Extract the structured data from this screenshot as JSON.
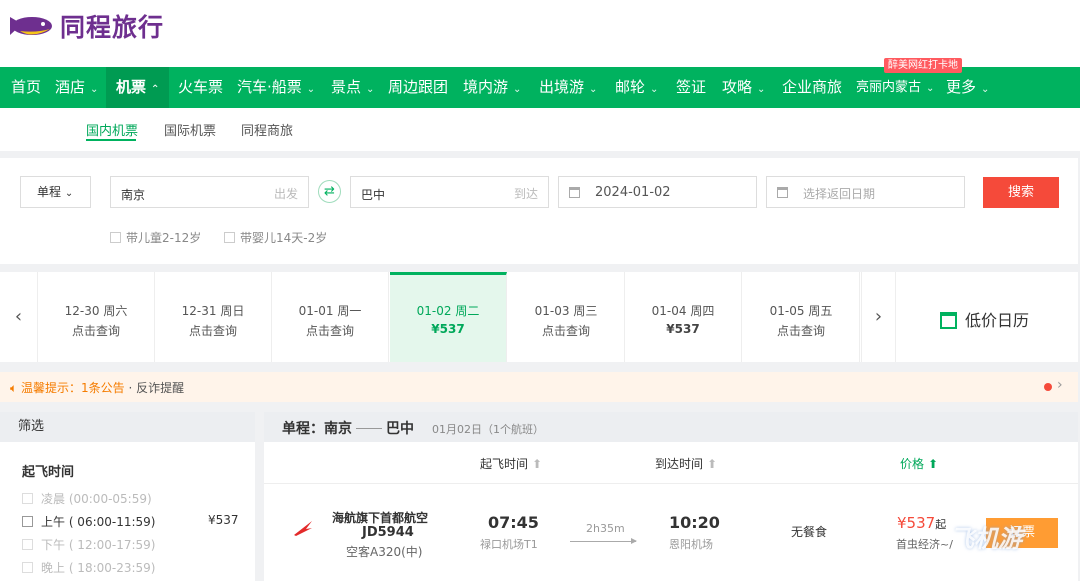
{
  "brand": {
    "name": "同程旅行",
    "color": "#6e2f8f",
    "icon": "flying-fish-logo-icon"
  },
  "nav": {
    "items": [
      {
        "label": "首页",
        "chevron": false
      },
      {
        "label": "酒店",
        "chevron": true
      },
      {
        "label": "机票",
        "chevron": true,
        "active": true
      },
      {
        "label": "火车票",
        "chevron": false
      },
      {
        "label": "汽车·船票",
        "chevron": true
      },
      {
        "label": "景点",
        "chevron": true
      },
      {
        "label": "周边跟团",
        "chevron": false
      },
      {
        "label": "境内游",
        "chevron": true
      },
      {
        "label": "出境游",
        "chevron": true
      },
      {
        "label": "邮轮",
        "chevron": true
      },
      {
        "label": "签证",
        "chevron": false
      },
      {
        "label": "攻略",
        "chevron": true
      },
      {
        "label": "企业商旅",
        "chevron": false
      },
      {
        "label": "亮丽内蒙古",
        "chevron": true
      },
      {
        "label": "更多",
        "chevron": true
      }
    ],
    "badge": "醉美网红打卡地",
    "color": "#00b25f"
  },
  "subnav": {
    "items": [
      "国内机票",
      "国际机票",
      "同程商旅"
    ],
    "active_index": 0
  },
  "search": {
    "trip_type": "单程",
    "from_city": "南京",
    "from_hint": "出发",
    "to_city": "巴中",
    "to_hint": "到达",
    "depart_date": "2024-01-02",
    "return_placeholder": "选择返回日期",
    "button": "搜索",
    "child_option": "带儿童2-12岁",
    "infant_option": "带婴儿14天-2岁",
    "button_color": "#f54a3a"
  },
  "datebar": {
    "days": [
      {
        "date": "12-30 周六",
        "info": "点击查询",
        "has_price": false
      },
      {
        "date": "12-31 周日",
        "info": "点击查询",
        "has_price": false
      },
      {
        "date": "01-01 周一",
        "info": "点击查询",
        "has_price": false
      },
      {
        "date": "01-02 周二",
        "info": "¥537",
        "has_price": true,
        "active": true
      },
      {
        "date": "01-03 周三",
        "info": "点击查询",
        "has_price": false
      },
      {
        "date": "01-04 周四",
        "info": "¥537",
        "has_price": true
      },
      {
        "date": "01-05 周五",
        "info": "点击查询",
        "has_price": false
      }
    ],
    "calendar_label": "低价日历",
    "calendar_icon": "calendar-icon"
  },
  "notice": {
    "title": "温馨提示：1条公告",
    "extra": "· 反诈提醒",
    "icon": "speaker-icon"
  },
  "filter": {
    "heading": "筛选",
    "section": "起飞时间",
    "slots": [
      {
        "label": "凌晨 (00:00-05:59)",
        "enabled": false,
        "price": ""
      },
      {
        "label": "上午 ( 06:00-11:59)",
        "enabled": true,
        "price": "¥537"
      },
      {
        "label": "下午 ( 12:00-17:59)",
        "enabled": false,
        "price": ""
      },
      {
        "label": "晚上 ( 18:00-23:59)",
        "enabled": false,
        "price": ""
      }
    ]
  },
  "results": {
    "route_label": "单程：南京",
    "route_dest": "巴中",
    "date": "01月02日",
    "count": "（1个航班）",
    "sort": {
      "depart": "起飞时间",
      "arrive": "到达时间",
      "price": "价格"
    },
    "flights": [
      {
        "airline": "海航旗下首都航空",
        "flight_no": "JD5944",
        "aircraft": "空客A320(中)",
        "depart_time": "07:45",
        "depart_airport": "禄口机场T1",
        "duration": "2h35m",
        "arrive_time": "10:20",
        "arrive_airport": "恩阳机场",
        "meal": "无餐食",
        "price": "¥537",
        "price_suffix": "起",
        "cabin": "首虫经济~/",
        "book_label": "订票"
      }
    ]
  },
  "watermark": "飞机游"
}
